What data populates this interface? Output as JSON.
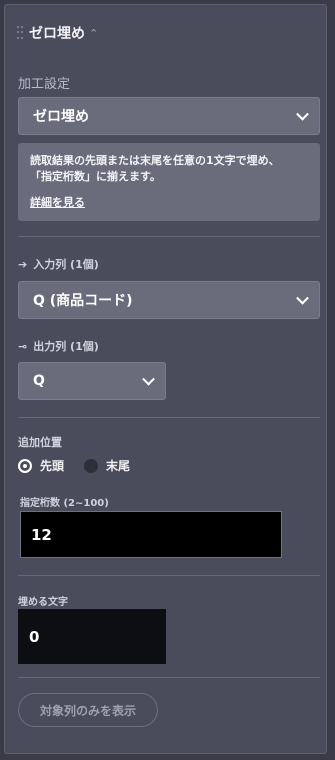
{
  "header": {
    "title": "ゼロ埋め"
  },
  "processing": {
    "label": "加工設定",
    "selected": "ゼロ埋め",
    "description_line1": "読取結果の先頭または末尾を任意の1文字で埋め、",
    "description_line2": "「指定桁数」に揃えます。",
    "details_link": "詳細を見る"
  },
  "input_column": {
    "label": "入力列 (1個)",
    "selected": "Q (商品コード)"
  },
  "output_column": {
    "label": "出力列 (1個)",
    "selected": "Q"
  },
  "position": {
    "label": "追加位置",
    "options": [
      {
        "label": "先頭",
        "checked": true
      },
      {
        "label": "末尾",
        "checked": false
      }
    ]
  },
  "digits": {
    "label": "指定桁数 (2~100)",
    "value": "12"
  },
  "fill_char": {
    "label": "埋める文字",
    "value": "0"
  },
  "footer": {
    "button_label": "対象列のみを表示"
  }
}
